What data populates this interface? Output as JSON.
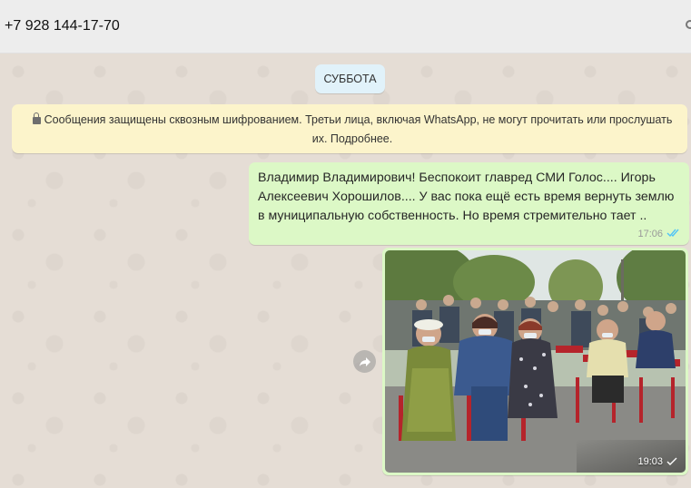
{
  "header": {
    "contact_name": "+7 928 144-17-70"
  },
  "chat": {
    "day_label": "СУББОТА",
    "encryption_notice": "Сообщения защищены сквозным шифрованием. Третьи лица, включая WhatsApp, не могут прочитать или прослушать их. Подробнее.",
    "messages": [
      {
        "type": "text",
        "text": "Владимир Владимирович! Беспокоит главред СМИ Голос.... Игорь Алексеевич Хорошилов.... У вас пока ещё есть время вернуть землю в муниципальную собственность. Но время стремительно тает ..",
        "time": "17:06",
        "status": "read"
      },
      {
        "type": "image",
        "time": "19:03",
        "status": "sent"
      }
    ]
  },
  "colors": {
    "chat_background": "#e5ddd5",
    "outgoing_bubble": "#dcf8c6",
    "notice_background": "#fcf4cb",
    "day_chip": "#e1f2fa",
    "read_ticks": "#4fc3f7"
  },
  "icons": [
    "lock-icon",
    "double-check-icon",
    "single-check-icon",
    "forward-icon",
    "search-icon"
  ]
}
